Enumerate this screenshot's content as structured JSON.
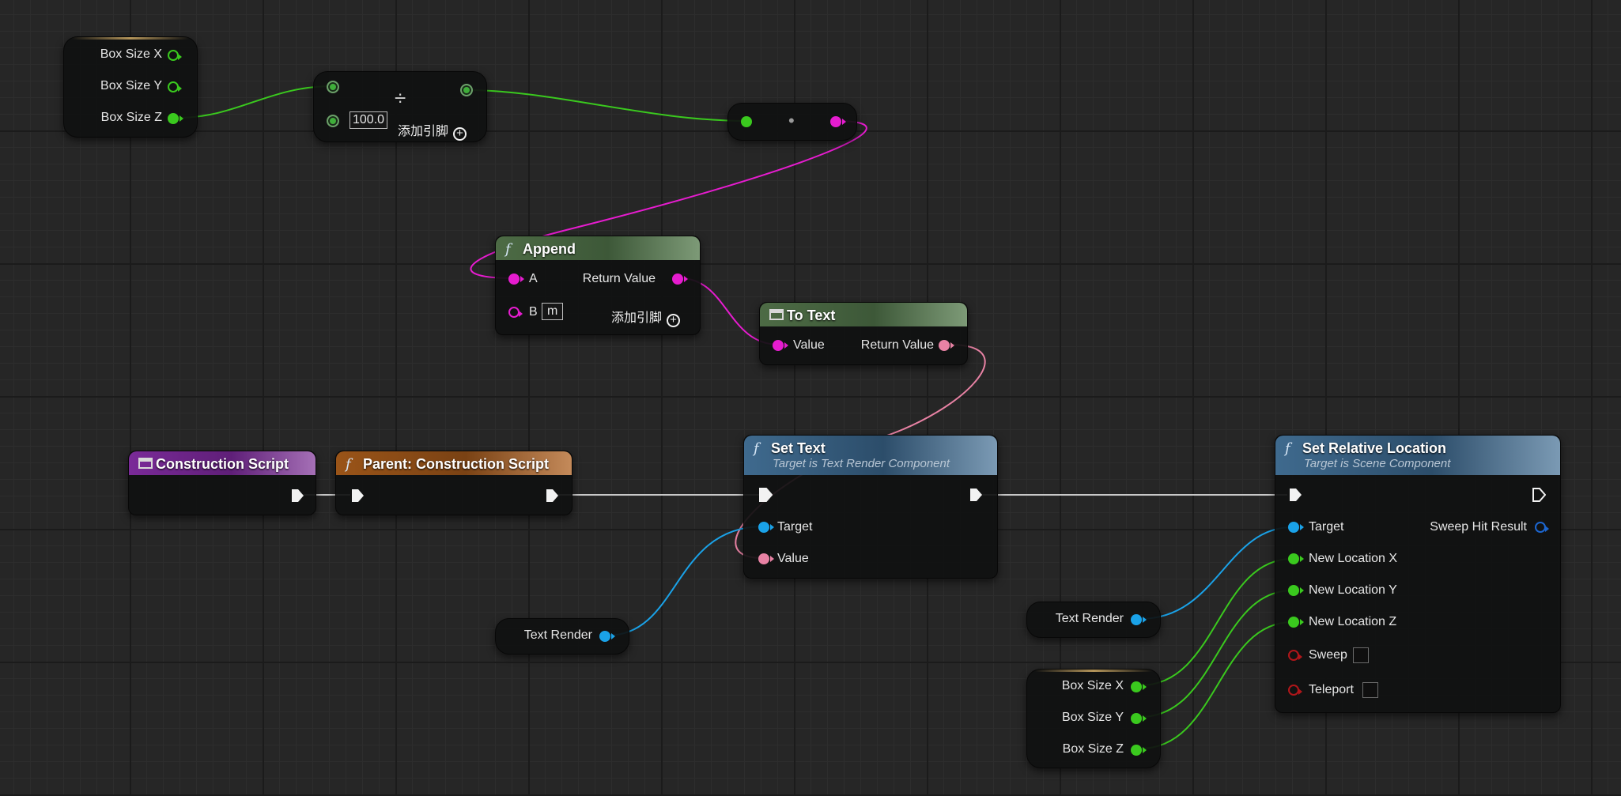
{
  "nodes": {
    "get_box_size_top": {
      "x_label": "Box Size X",
      "y_label": "Box Size Y",
      "z_label": "Box Size Z"
    },
    "divide": {
      "symbol": "÷",
      "default_value": "100.0",
      "add_pin_label": "添加引脚"
    },
    "to_string": {
      "symbol": "•"
    },
    "append": {
      "title": "Append",
      "pin_a": "A",
      "pin_b": "B",
      "pin_b_value": "m",
      "return_label": "Return Value",
      "add_pin_label": "添加引脚"
    },
    "to_text": {
      "title": "To Text",
      "value_label": "Value",
      "return_label": "Return Value"
    },
    "construction_script": {
      "title": "Construction Script"
    },
    "parent_construction_script": {
      "title": "Parent: Construction Script"
    },
    "set_text": {
      "title": "Set Text",
      "subtitle": "Target is Text Render Component",
      "target_label": "Target",
      "value_label": "Value"
    },
    "text_render_left": {
      "label": "Text Render"
    },
    "text_render_right": {
      "label": "Text Render"
    },
    "get_box_size_bottom": {
      "x_label": "Box Size X",
      "y_label": "Box Size Y",
      "z_label": "Box Size Z"
    },
    "set_relative_location": {
      "title": "Set Relative Location",
      "subtitle": "Target is Scene Component",
      "target_label": "Target",
      "sweep_hit_label": "Sweep Hit Result",
      "loc_x_label": "New Location X",
      "loc_y_label": "New Location Y",
      "loc_z_label": "New Location Z",
      "sweep_label": "Sweep",
      "teleport_label": "Teleport"
    }
  },
  "colors": {
    "float_pin": "#3ac91e",
    "string_pin": "#e61ccf",
    "text_pin": "#e882a4",
    "object_pin": "#1aa2e8",
    "bool_pin": "#b0161a",
    "struct_pin": "#1c66d0",
    "exec_wire": "#c8c8c8",
    "pure_function_header": "#4d6b45",
    "function_header": "#3f6a8e",
    "event_header": "#7a2a98",
    "parent_call_header": "#9a5418"
  }
}
